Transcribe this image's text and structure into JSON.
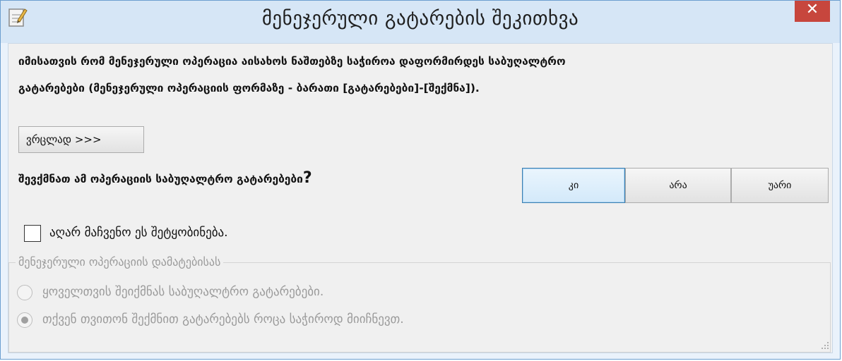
{
  "window": {
    "title": "მენეჯერული გატარების შეკითხვა",
    "close_label": "✕"
  },
  "message": {
    "line1": "იმისათვის რომ მენეჯერული ოპერაცია აისახოს  ნაშთებზე საჭიროა დაფორმირდეს საბუღალტრო",
    "line2": "გატარებები (მენეჯერული ოპერაციის ფორმაზე - ბარათი [გატარებები]-[შექმნა])."
  },
  "buttons": {
    "details": "ვრცლად >>>",
    "yes": "კი",
    "no": "არა",
    "cancel": "უარი"
  },
  "question": {
    "text": "შევქმნათ ამ ოპერაციის საბუღალტრო გატარებები",
    "mark": "?"
  },
  "dont_show": {
    "label": "აღარ მაჩვენო ეს შეტყობინება.",
    "checked": false
  },
  "group": {
    "legend": "მენეჯერული ოპერაციის დამატებისას",
    "options": [
      {
        "label": "ყოველთვის შეიქმნას საბუღალტრო გატარებები.",
        "checked": false
      },
      {
        "label": "თქვენ თვითონ შექმნით გატარებებს როცა საჭიროდ მიიჩნევთ.",
        "checked": true
      }
    ]
  },
  "colors": {
    "title_bg": "#d6e6f6",
    "close_red": "#c7463d",
    "disabled_text": "#9a9a9a"
  }
}
